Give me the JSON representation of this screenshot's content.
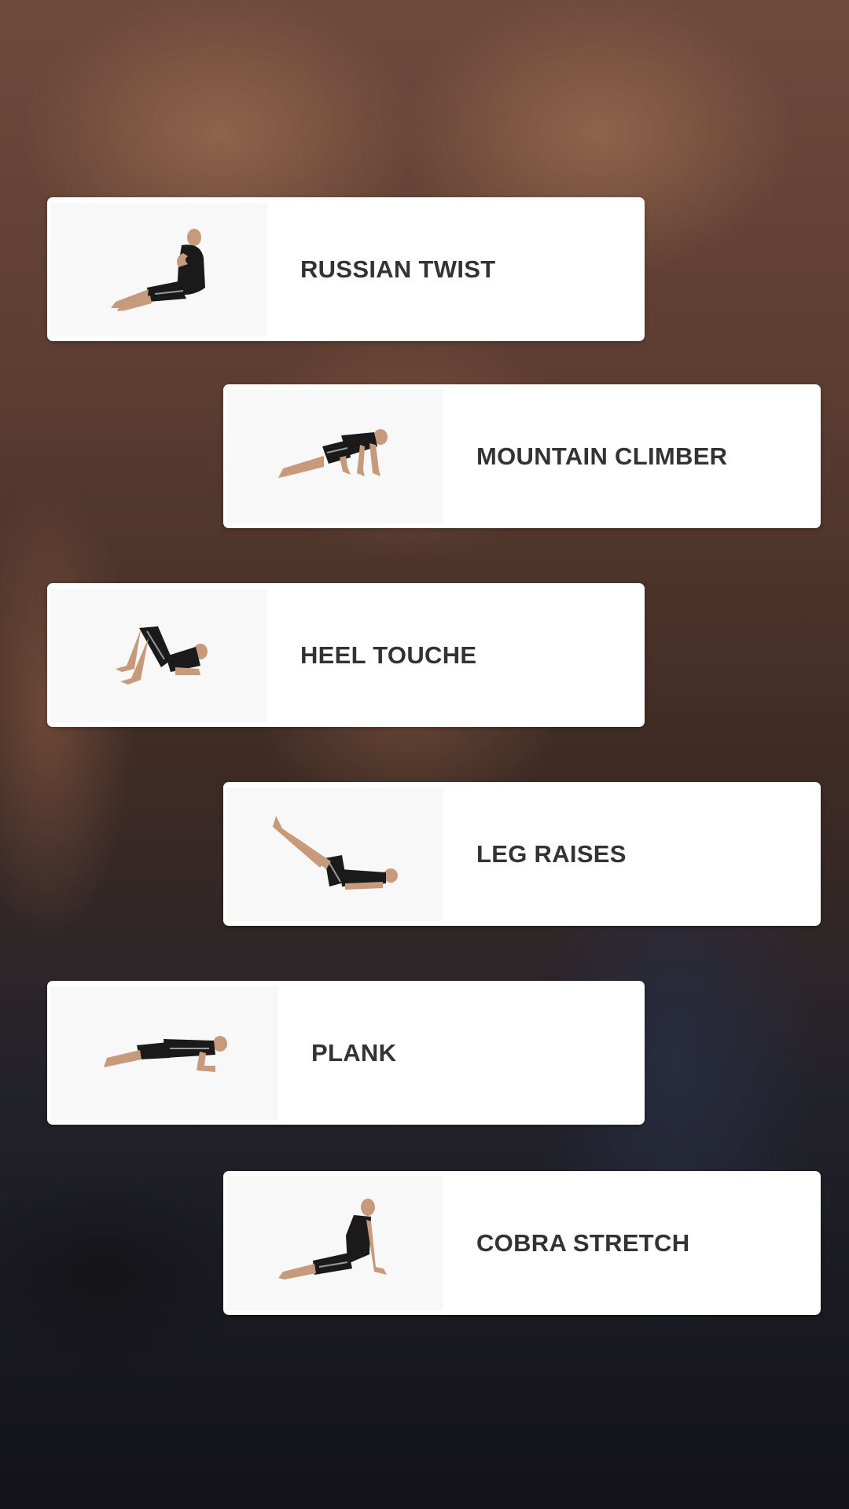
{
  "background": {
    "description_icon": "muscular-torso-photo-icon"
  },
  "colors": {
    "card_background": "#ffffff",
    "label_text": "#333333"
  },
  "exercises": [
    {
      "label": "RUSSIAN TWIST",
      "icon": "russian-twist-pose-icon"
    },
    {
      "label": "MOUNTAIN CLIMBER",
      "icon": "mountain-climber-pose-icon"
    },
    {
      "label": "HEEL TOUCHE",
      "icon": "heel-touch-pose-icon"
    },
    {
      "label": "LEG RAISES",
      "icon": "leg-raises-pose-icon"
    },
    {
      "label": "PLANK",
      "icon": "plank-pose-icon"
    },
    {
      "label": "COBRA STRETCH",
      "icon": "cobra-stretch-pose-icon"
    }
  ]
}
